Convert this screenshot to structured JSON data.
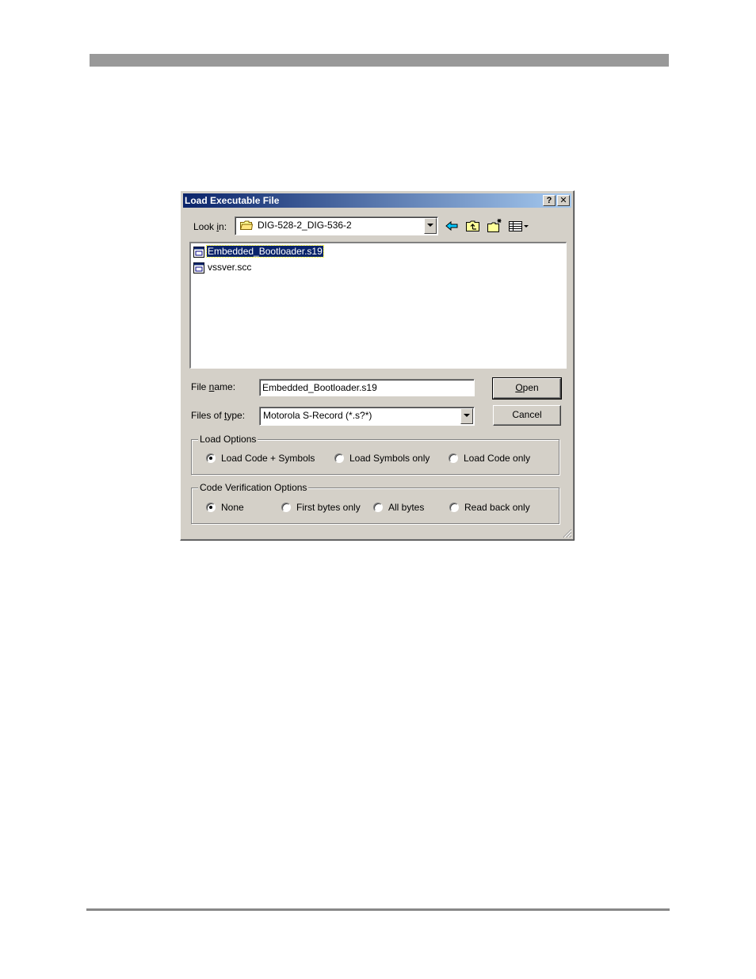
{
  "dialog": {
    "title": "Load Executable File",
    "help_symbol": "?",
    "close_symbol": "✕"
  },
  "lookin": {
    "label_prefix": "Look ",
    "label_accel": "i",
    "label_suffix": "n:",
    "value": "DIG-528-2_DIG-536-2"
  },
  "toolbar": {
    "icons": [
      "back-arrow-icon",
      "up-folder-icon",
      "new-folder-icon",
      "view-menu-icon"
    ]
  },
  "files": [
    {
      "name": "Embedded_Bootloader.s19",
      "selected": true
    },
    {
      "name": "vssver.scc",
      "selected": false
    }
  ],
  "filename": {
    "label_prefix": "File ",
    "label_accel": "n",
    "label_suffix": "ame:",
    "value": "Embedded_Bootloader.s19"
  },
  "filetype": {
    "label_prefix": "Files of ",
    "label_accel": "t",
    "label_suffix": "ype:",
    "value": "Motorola S-Record (*.s?*)"
  },
  "buttons": {
    "open_accel": "O",
    "open_rest": "pen",
    "cancel": "Cancel"
  },
  "load_options": {
    "title": "Load Options",
    "options": [
      "Load Code + Symbols",
      "Load Symbols only",
      "Load Code only"
    ],
    "selected_index": 0
  },
  "verify_options": {
    "title": "Code Verification Options",
    "options": [
      "None",
      "First bytes only",
      "All bytes",
      "Read back only"
    ],
    "selected_index": 0
  },
  "colors": {
    "title_bar": "#0a246a",
    "face": "#d4d0c8",
    "selection": "#0a246a",
    "page_rule": "#999999"
  }
}
